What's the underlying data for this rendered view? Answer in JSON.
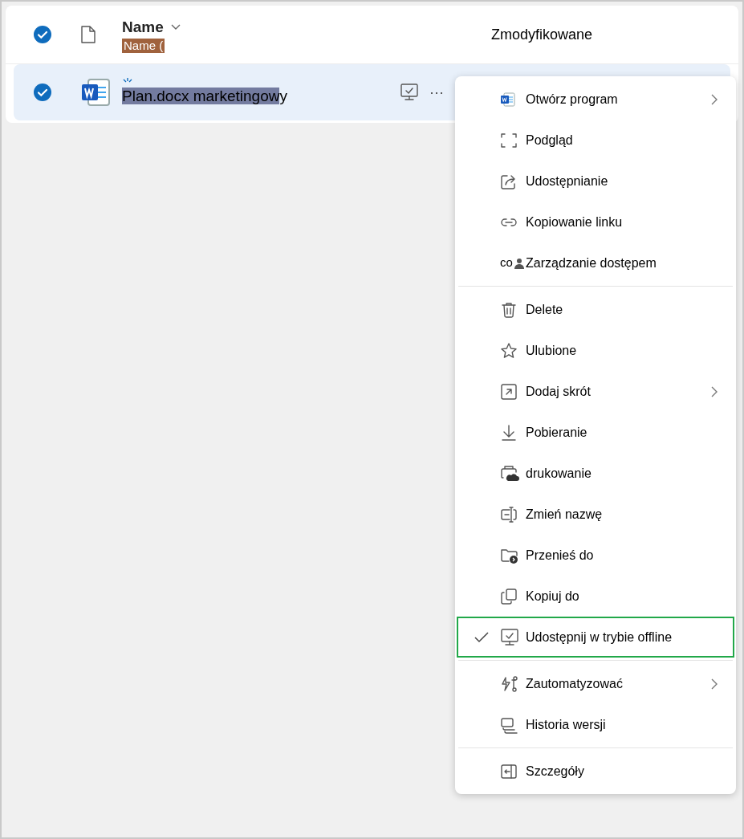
{
  "table": {
    "select_all": {
      "checked": true
    },
    "columns": [
      {
        "label": "Name",
        "tag": "Name ("
      },
      {
        "label": "Zmodyfikowane"
      }
    ],
    "rows": [
      {
        "checked": true,
        "selected": true,
        "name_highlighted": "Plan.docx marketingow",
        "name_rest": "y",
        "more": "···"
      }
    ]
  },
  "context_menu": {
    "items": [
      {
        "kind": "item",
        "label": "Otwórz program",
        "submenu": true,
        "checked": false,
        "outlined": false
      },
      {
        "kind": "item",
        "label": "Podgląd",
        "submenu": false,
        "checked": false,
        "outlined": false
      },
      {
        "kind": "item",
        "label": "Udostępnianie",
        "submenu": false,
        "checked": false,
        "outlined": false
      },
      {
        "kind": "item",
        "label": "Kopiowanie linku",
        "submenu": false,
        "checked": false,
        "outlined": false
      },
      {
        "kind": "item",
        "label": "Zarządzanie dostępem",
        "prefix": "co",
        "submenu": false,
        "checked": false,
        "outlined": false
      },
      {
        "kind": "divider"
      },
      {
        "kind": "item",
        "label": "Delete",
        "submenu": false,
        "checked": false,
        "outlined": false
      },
      {
        "kind": "item",
        "label": "Ulubione",
        "submenu": false,
        "checked": false,
        "outlined": false
      },
      {
        "kind": "item",
        "label": "Dodaj skrót",
        "submenu": true,
        "checked": false,
        "outlined": false
      },
      {
        "kind": "item",
        "label": "Pobieranie",
        "submenu": false,
        "checked": false,
        "outlined": false
      },
      {
        "kind": "item",
        "label": "drukowanie",
        "submenu": false,
        "checked": false,
        "outlined": false
      },
      {
        "kind": "item",
        "label": "Zmień nazwę",
        "submenu": false,
        "checked": false,
        "outlined": false
      },
      {
        "kind": "item",
        "label": "Przenieś do",
        "submenu": false,
        "checked": false,
        "outlined": false
      },
      {
        "kind": "item",
        "label": "Kopiuj do",
        "submenu": false,
        "checked": false,
        "outlined": false
      },
      {
        "kind": "item",
        "label": "Udostępnij w trybie offline",
        "submenu": false,
        "checked": true,
        "outlined": true
      },
      {
        "kind": "divider"
      },
      {
        "kind": "item",
        "label": "Zautomatyzować",
        "submenu": true,
        "checked": false,
        "outlined": false
      },
      {
        "kind": "item",
        "label": "Historia wersji",
        "submenu": false,
        "checked": false,
        "outlined": false
      },
      {
        "kind": "divider"
      },
      {
        "kind": "item",
        "label": "Szczegóły",
        "submenu": false,
        "checked": false,
        "outlined": false
      }
    ]
  }
}
